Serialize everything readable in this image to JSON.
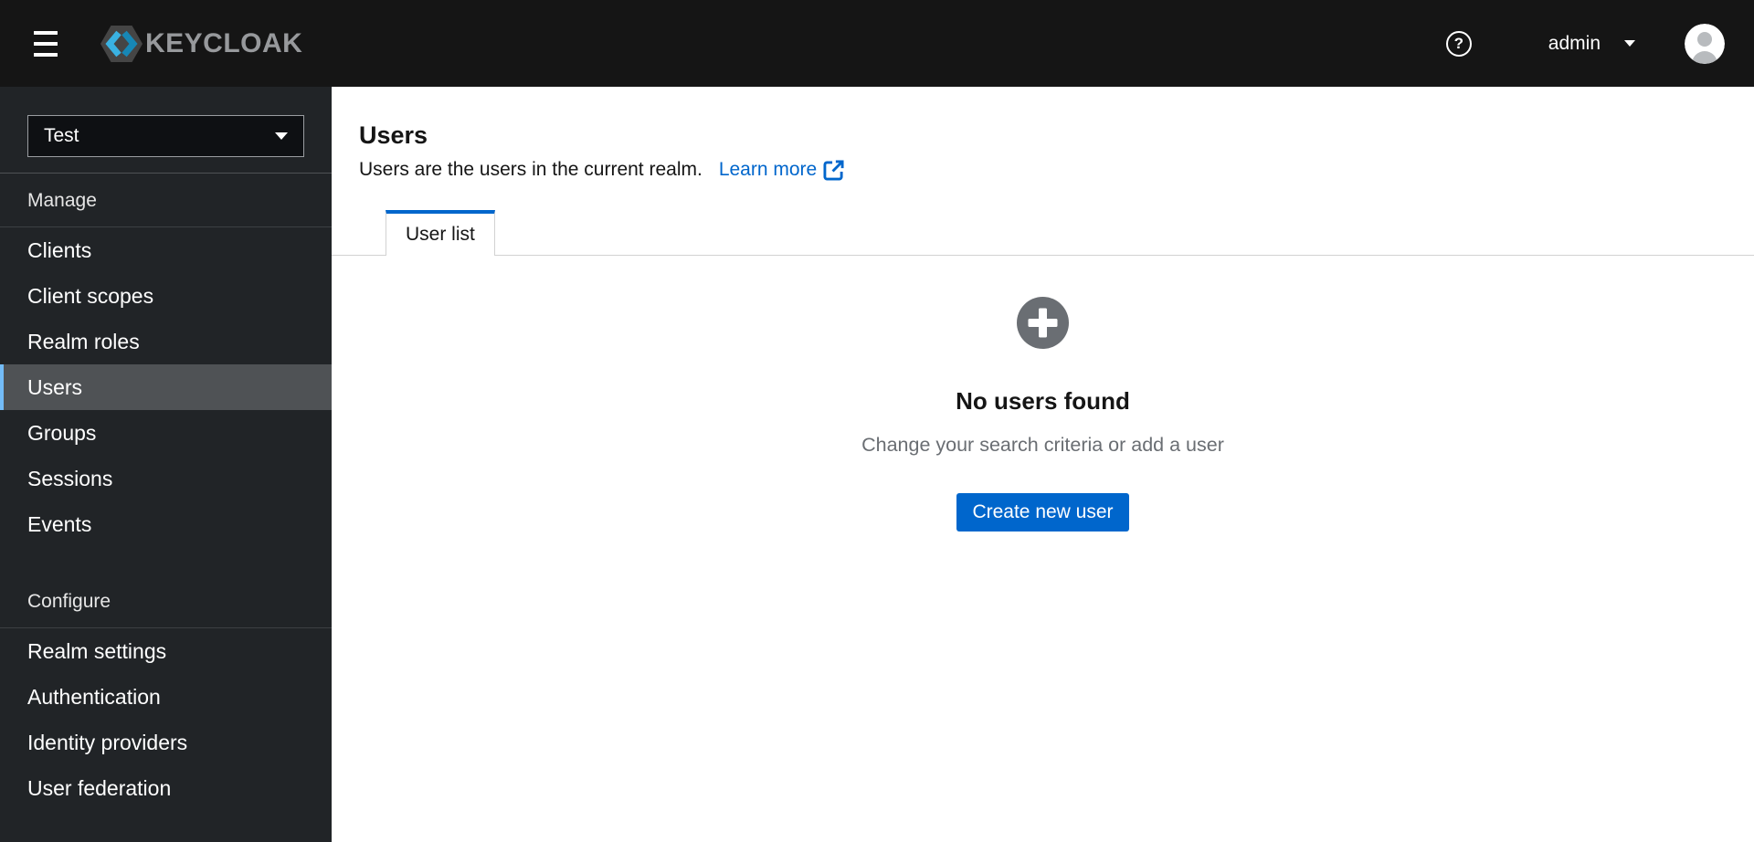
{
  "masthead": {
    "logo_text": "KEYCLOAK",
    "help_glyph": "?",
    "username": "admin"
  },
  "sidebar": {
    "realm_selector": {
      "value": "Test"
    },
    "sections": [
      {
        "title": "Manage",
        "items": [
          "Clients",
          "Client scopes",
          "Realm roles",
          "Users",
          "Groups",
          "Sessions",
          "Events"
        ],
        "selected": "Users"
      },
      {
        "title": "Configure",
        "items": [
          "Realm settings",
          "Authentication",
          "Identity providers",
          "User federation"
        ]
      }
    ]
  },
  "main": {
    "title": "Users",
    "description": "Users are the users in the current realm.",
    "learn_more_label": "Learn more",
    "tabs": [
      {
        "label": "User list",
        "active": true
      }
    ],
    "empty_state": {
      "icon": "plus-circle-icon",
      "title": "No users found",
      "body": "Change your search criteria or add a user",
      "action_label": "Create new user"
    }
  },
  "colors": {
    "accent": "#0066cc",
    "masthead_bg": "#151515",
    "sidebar_bg": "#212427",
    "nav_selected_bg": "#4f5255",
    "nav_selected_indicator": "#73bcf7",
    "muted_text": "#6a6e73",
    "tab_border": "#d2d2d2",
    "logo_blue_light": "#3ab2e2",
    "logo_blue_dark": "#1787b5"
  }
}
